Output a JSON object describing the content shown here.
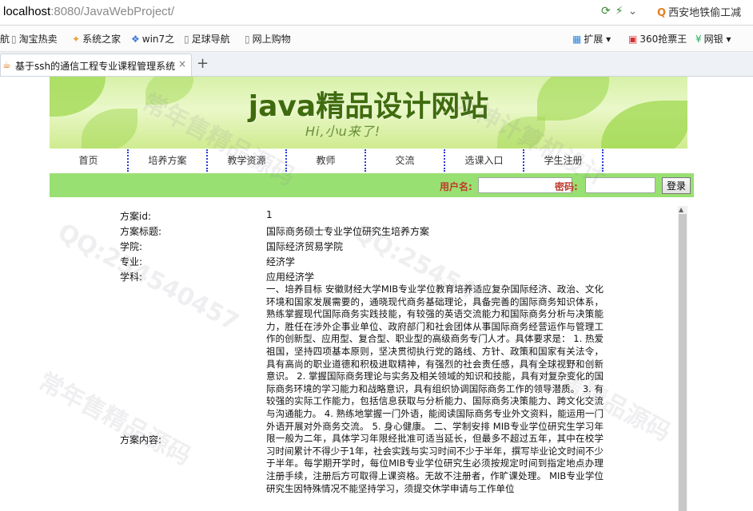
{
  "browser": {
    "url_host": "localhost",
    "url_path": ":8080/JavaWebProject/",
    "search_text": "西安地铁偷工减",
    "bookmarks": [
      "淘宝热卖",
      "系统之家",
      "win7之",
      "足球导航",
      "网上购物"
    ],
    "bookmark_prefix": "航",
    "right_items": [
      "扩展",
      "360抢票王",
      "网银"
    ],
    "tab_title": "基于ssh的通信工程专业课程管理系统",
    "tab_close": "×",
    "new_tab": "+"
  },
  "site": {
    "banner_title": "java精品设计网站",
    "banner_sub": "Hi,小u来了!",
    "nav": [
      "首页",
      "培养方案",
      "教学资源",
      "教师",
      "交流",
      "选课入口",
      "学生注册"
    ],
    "login": {
      "username_label": "用户名:",
      "password_label": "密码:",
      "button": "登录"
    }
  },
  "detail": {
    "fields": [
      {
        "label": "方案id:",
        "value": "1"
      },
      {
        "label": "方案标题:",
        "value": "国际商务硕士专业学位研究生培养方案"
      },
      {
        "label": "学院:",
        "value": "国际经济贸易学院"
      },
      {
        "label": "专业:",
        "value": "经济学"
      },
      {
        "label": "学科:",
        "value": "应用经济学"
      }
    ],
    "content_label": "方案内容:",
    "content": "一、培养目标 安徽财经大学MIB专业学位教育培养适应复杂国际经济、政治、文化环境和国家发展需要的，通晓现代商务基础理论，具备完善的国际商务知识体系，熟练掌握现代国际商务实践技能，有较强的英语交流能力和国际商务分析与决策能力，胜任在涉外企事业单位、政府部门和社会团体从事国际商务经营运作与管理工作的创新型、应用型、复合型、职业型的高级商务专门人才。具体要求是： 1. 热爱祖国，坚持四项基本原则，坚决贯彻执行党的路线、方针、政策和国家有关法令，具有高尚的职业道德和积极进取精神，有强烈的社会责任感，具有全球视野和创新意识。 2. 掌握国际商务理论与实务及相关领域的知识和技能，具有对复杂变化的国际商务环境的学习能力和战略意识，具有组织协调国际商务工作的领导潜质。 3. 有较强的实际工作能力，包括信息获取与分析能力、国际商务决策能力、跨文化交流与沟通能力。 4. 熟练地掌握一门外语，能阅读国际商务专业外文资料，能运用一门外语开展对外商务交流。 5. 身心健康。 二、学制安排 MIB专业学位研究生学习年限一般为二年，具体学习年限经批准可适当延长，但最多不超过五年，其中在校学习时间累计不得少于1年，社会实践与实习时间不少于半年，撰写毕业论文时间不少于半年。每学期开学时，每位MIB专业学位研究生必须按规定时间到指定地点办理注册手续，注册后方可取得上课资格。无故不注册者，作旷课处理。 MIB专业学位研究生因特殊情况不能坚持学习，须提交休学申请与工作单位"
  },
  "watermarks": [
    "常年售精品源码",
    "QQ:254540457",
    "大神计算机设计"
  ]
}
